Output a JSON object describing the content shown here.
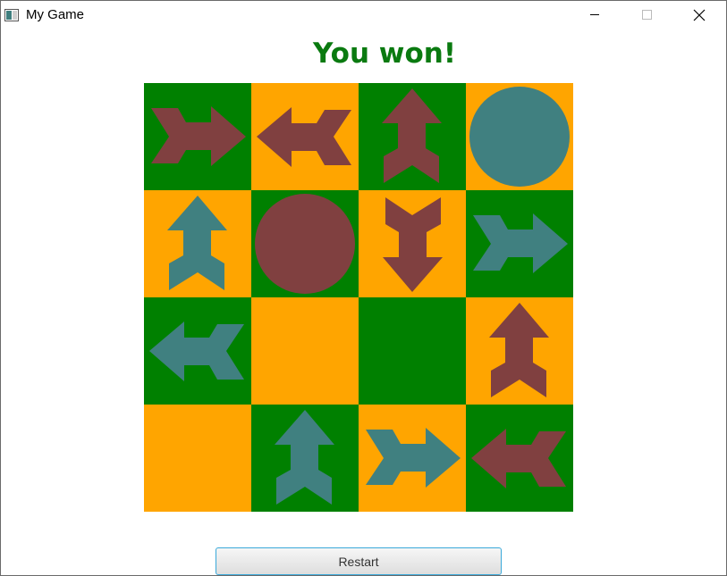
{
  "window": {
    "title": "My Game",
    "controls": {
      "minimize": "minimize-icon",
      "maximize": "maximize-icon",
      "close": "close-icon"
    }
  },
  "status": {
    "message": "You won!",
    "color": "#0a7a10"
  },
  "colors": {
    "green": "#008000",
    "orange": "#ffa500",
    "red_piece": "#804040",
    "teal_piece": "#408080"
  },
  "board": {
    "rows": 4,
    "cols": 4,
    "cells": [
      {
        "bg": "green",
        "piece": "arrow",
        "dir": "right",
        "color": "red"
      },
      {
        "bg": "orange",
        "piece": "arrow",
        "dir": "left",
        "color": "red"
      },
      {
        "bg": "green",
        "piece": "arrow",
        "dir": "up",
        "color": "red"
      },
      {
        "bg": "orange",
        "piece": "circle",
        "color": "teal"
      },
      {
        "bg": "orange",
        "piece": "arrow",
        "dir": "up",
        "color": "teal"
      },
      {
        "bg": "green",
        "piece": "circle",
        "color": "red"
      },
      {
        "bg": "orange",
        "piece": "arrow",
        "dir": "down",
        "color": "red"
      },
      {
        "bg": "green",
        "piece": "arrow",
        "dir": "right",
        "color": "teal"
      },
      {
        "bg": "green",
        "piece": "arrow",
        "dir": "left",
        "color": "teal"
      },
      {
        "bg": "orange",
        "piece": "none"
      },
      {
        "bg": "green",
        "piece": "none"
      },
      {
        "bg": "orange",
        "piece": "arrow",
        "dir": "up",
        "color": "red"
      },
      {
        "bg": "orange",
        "piece": "none"
      },
      {
        "bg": "green",
        "piece": "arrow",
        "dir": "up",
        "color": "teal"
      },
      {
        "bg": "orange",
        "piece": "arrow",
        "dir": "right",
        "color": "teal"
      },
      {
        "bg": "green",
        "piece": "arrow",
        "dir": "left",
        "color": "red"
      }
    ]
  },
  "restart": {
    "label": "Restart"
  }
}
